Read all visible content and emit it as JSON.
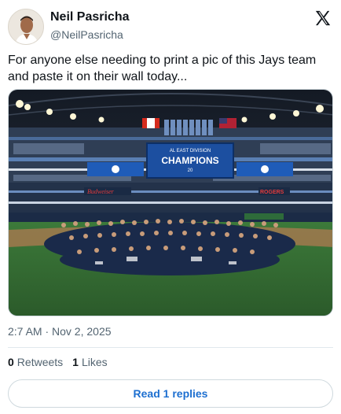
{
  "author": {
    "name": "Neil Pasricha",
    "handle": "@NeilPasricha",
    "avatar_icon": "profile-photo"
  },
  "platform_icon": "x-logo-icon",
  "tweet": {
    "text_line1": "For anyone else needing to print a pic of this Jays team",
    "text_line2": "and paste it on their wall today...",
    "timestamp": "2:7 AM · Nov 2, 2025"
  },
  "media": {
    "scoreboard_line1": "AL EAST DIVISION",
    "scoreboard_line2": "CHAMPIONS",
    "scoreboard_year": "20",
    "left_banner": "Budweiser",
    "right_banner": "ROGERS"
  },
  "stats": {
    "retweets_count": "0",
    "retweets_label": "Retweets",
    "likes_count": "1",
    "likes_label": "Likes"
  },
  "actions": {
    "read_replies": "Read 1 replies"
  },
  "colors": {
    "link_blue": "#1d6fd0",
    "secondary_text": "#536471",
    "jays_blue": "#134a8e"
  }
}
